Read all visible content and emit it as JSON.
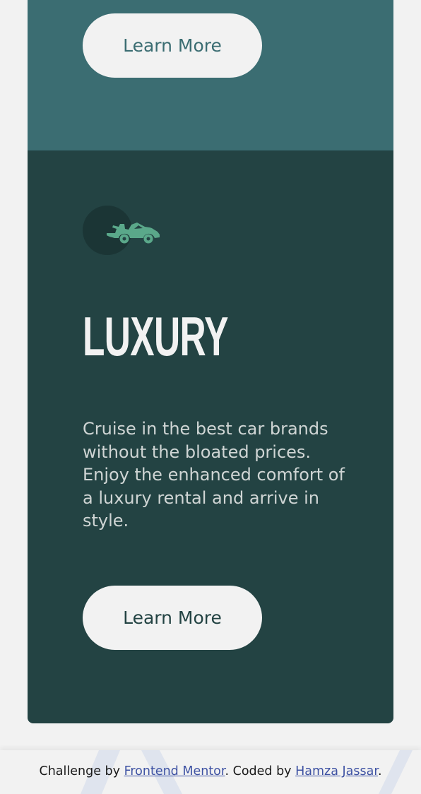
{
  "top_card": {
    "button_label": "Learn More"
  },
  "luxury_card": {
    "icon": "car-icon",
    "title": "LUXURY",
    "description": "Cruise in the best car brands without the bloated prices. Enjoy the enhanced comfort of a luxury rental and arrive in style.",
    "button_label": "Learn More"
  },
  "footer": {
    "prefix": "Challenge by ",
    "link1": "Frontend Mentor",
    "middle": ". Coded by ",
    "link2": "Hamza Jassar",
    "suffix": "."
  },
  "colors": {
    "background": "#f2f2f2",
    "top_card": "#3b6d72",
    "luxury_card": "#234343",
    "icon_accent": "#5aa88a",
    "link": "#3e52a3"
  }
}
